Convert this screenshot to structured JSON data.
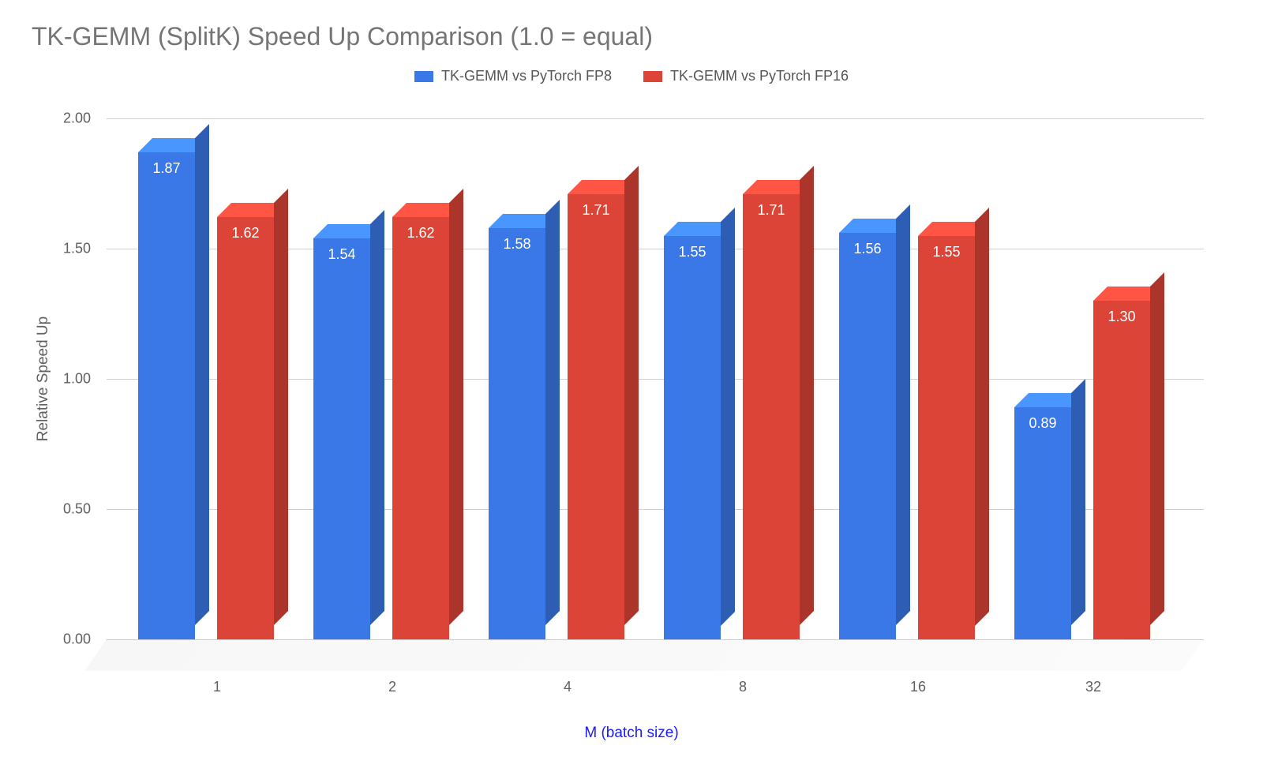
{
  "chart_data": {
    "type": "bar",
    "title": "TK-GEMM (SplitK) Speed Up Comparison (1.0 = equal)",
    "xlabel": "M (batch size)",
    "ylabel": "Relative Speed Up",
    "ylim": [
      0,
      2.0
    ],
    "yticks": [
      "0.00",
      "0.50",
      "1.00",
      "1.50",
      "2.00"
    ],
    "categories": [
      "1",
      "2",
      "4",
      "8",
      "16",
      "32"
    ],
    "series": [
      {
        "name": "TK-GEMM vs PyTorch FP8",
        "color": "#3b78e7",
        "values": [
          1.87,
          1.54,
          1.58,
          1.55,
          1.56,
          0.89
        ]
      },
      {
        "name": "TK-GEMM vs PyTorch FP16",
        "color": "#db4437",
        "values": [
          1.62,
          1.62,
          1.71,
          1.71,
          1.55,
          1.3
        ]
      }
    ]
  }
}
